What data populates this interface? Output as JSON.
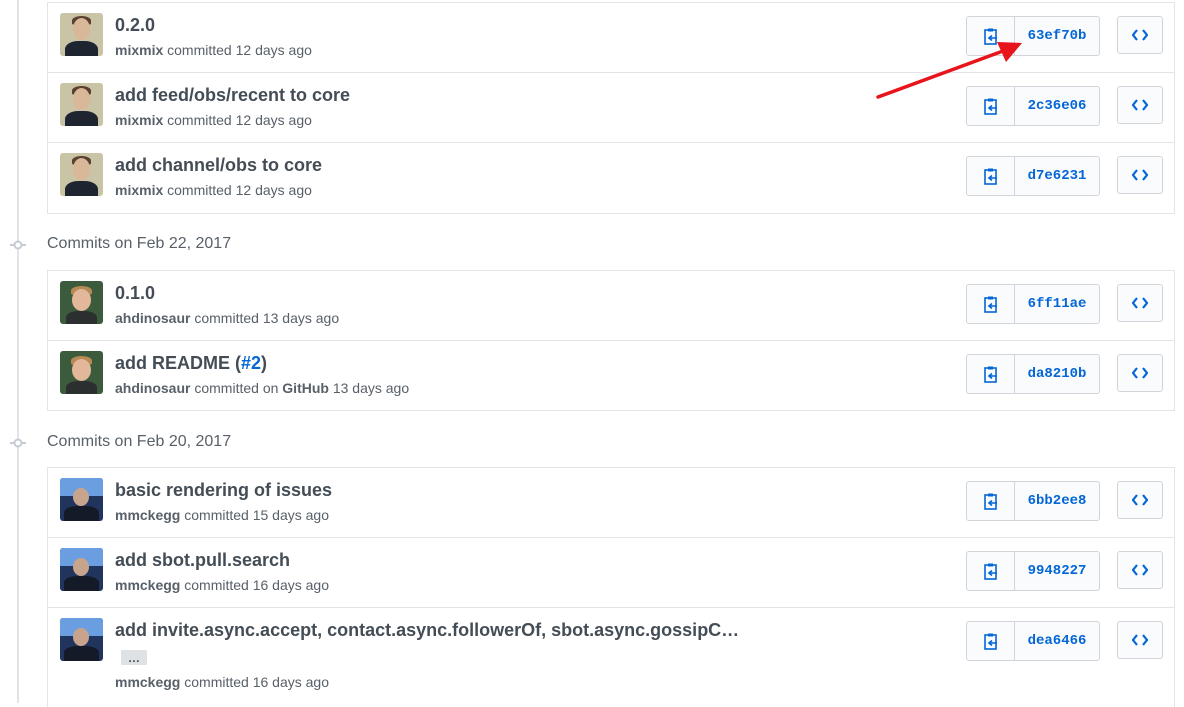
{
  "groups": [
    {
      "header": "",
      "commits": [
        {
          "title": "0.2.0",
          "author": "mixmix",
          "action": "committed",
          "time": "12 days ago",
          "sha": "63ef70b",
          "avatar": "mixmix-avatar"
        },
        {
          "title": "add feed/obs/recent to core",
          "author": "mixmix",
          "action": "committed",
          "time": "12 days ago",
          "sha": "2c36e06",
          "avatar": "mixmix-avatar"
        },
        {
          "title": "add channel/obs to core",
          "author": "mixmix",
          "action": "committed",
          "time": "12 days ago",
          "sha": "d7e6231",
          "avatar": "mixmix-avatar"
        }
      ]
    },
    {
      "header": "Commits on Feb 22, 2017",
      "commits": [
        {
          "title": "0.1.0",
          "author": "ahdinosaur",
          "action": "committed",
          "time": "13 days ago",
          "sha": "6ff11ae",
          "avatar": "ahdinosaur-avatar"
        },
        {
          "title_prefix": "add README (",
          "title_link": "#2",
          "title_suffix": ")",
          "author": "ahdinosaur",
          "action": "committed on",
          "via": "GitHub",
          "time": "13 days ago",
          "sha": "da8210b",
          "avatar": "ahdinosaur-avatar"
        }
      ]
    },
    {
      "header": "Commits on Feb 20, 2017",
      "commits": [
        {
          "title": "basic rendering of issues",
          "author": "mmckegg",
          "action": "committed",
          "time": "15 days ago",
          "sha": "6bb2ee8",
          "avatar": "mmckegg-avatar"
        },
        {
          "title": "add sbot.pull.search",
          "author": "mmckegg",
          "action": "committed",
          "time": "16 days ago",
          "sha": "9948227",
          "avatar": "mmckegg-avatar"
        },
        {
          "title": "add invite.async.accept, contact.async.followerOf, sbot.async.gossipC…",
          "ellipsis": "…",
          "author": "mmckegg",
          "action": "committed",
          "time": "16 days ago",
          "sha": "dea6466",
          "avatar": "mmckegg-avatar"
        }
      ]
    }
  ],
  "icons": {
    "copy": "clippy-icon",
    "browse": "code-icon",
    "group": "git-commit-icon"
  },
  "colors": {
    "link": "#0366d6",
    "annotation_arrow": "#e8141c"
  }
}
